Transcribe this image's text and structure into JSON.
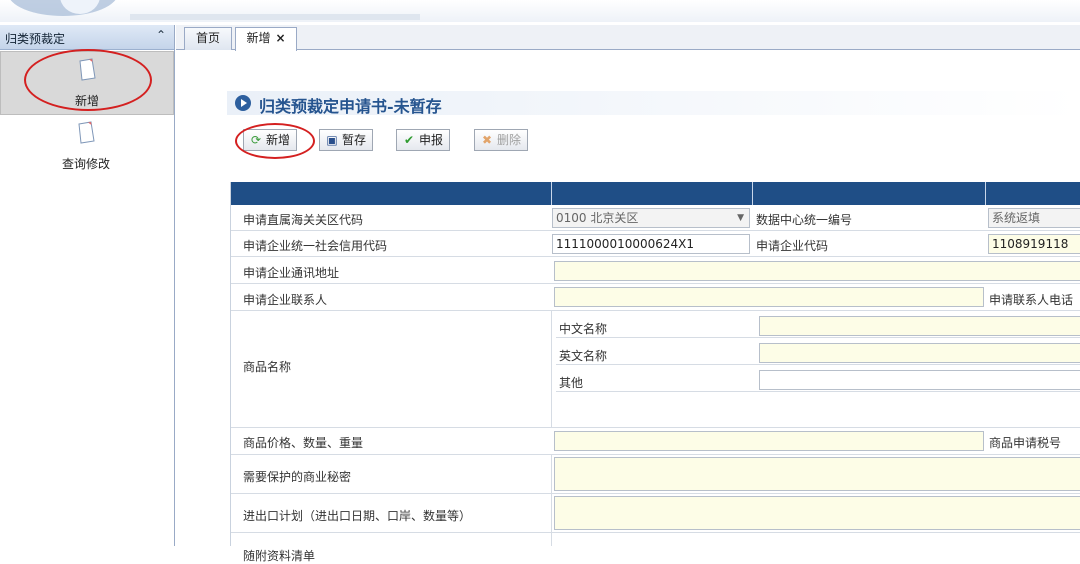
{
  "sidebar": {
    "header": "归类预裁定",
    "collapse_icon": "double-chevron-up-icon",
    "items": [
      {
        "label": "新增",
        "icon": "document-icon"
      },
      {
        "label": "查询修改",
        "icon": "document-icon"
      }
    ]
  },
  "tabs": [
    {
      "label": "首页"
    },
    {
      "label": "新增",
      "close": "×"
    }
  ],
  "form_title": "归类预裁定申请书-未暂存",
  "toolbar": {
    "add": "新增",
    "save": "暂存",
    "declare": "申报",
    "delete": "删除"
  },
  "form": {
    "customs_label": "申请直属海关关区代码",
    "customs_value": "0100 北京关区",
    "dc_label": "数据中心统一编号",
    "dc_value": "系统返填",
    "credit_label": "申请企业统一社会信用代码",
    "credit_value": "1111000010000624X1",
    "ent_code_label": "申请企业代码",
    "ent_code_value": "1108919118",
    "address_label": "申请企业通讯地址",
    "contact_label": "申请企业联系人",
    "contact_phone_label": "申请联系人电话",
    "goods_name_label": "商品名称",
    "cn_name_label": "中文名称",
    "en_name_label": "英文名称",
    "other_label": "其他",
    "price_label": "商品价格、数量、重量",
    "tax_label": "商品申请税号",
    "secret_label": "需要保护的商业秘密",
    "plan_label": "进出口计划（进出口日期、口岸、数量等）",
    "attach_label": "随附资料清单"
  },
  "colors": {
    "header_band": "#1f4e86",
    "field_bg": "#fdfde7",
    "highlight": "#d42020"
  }
}
